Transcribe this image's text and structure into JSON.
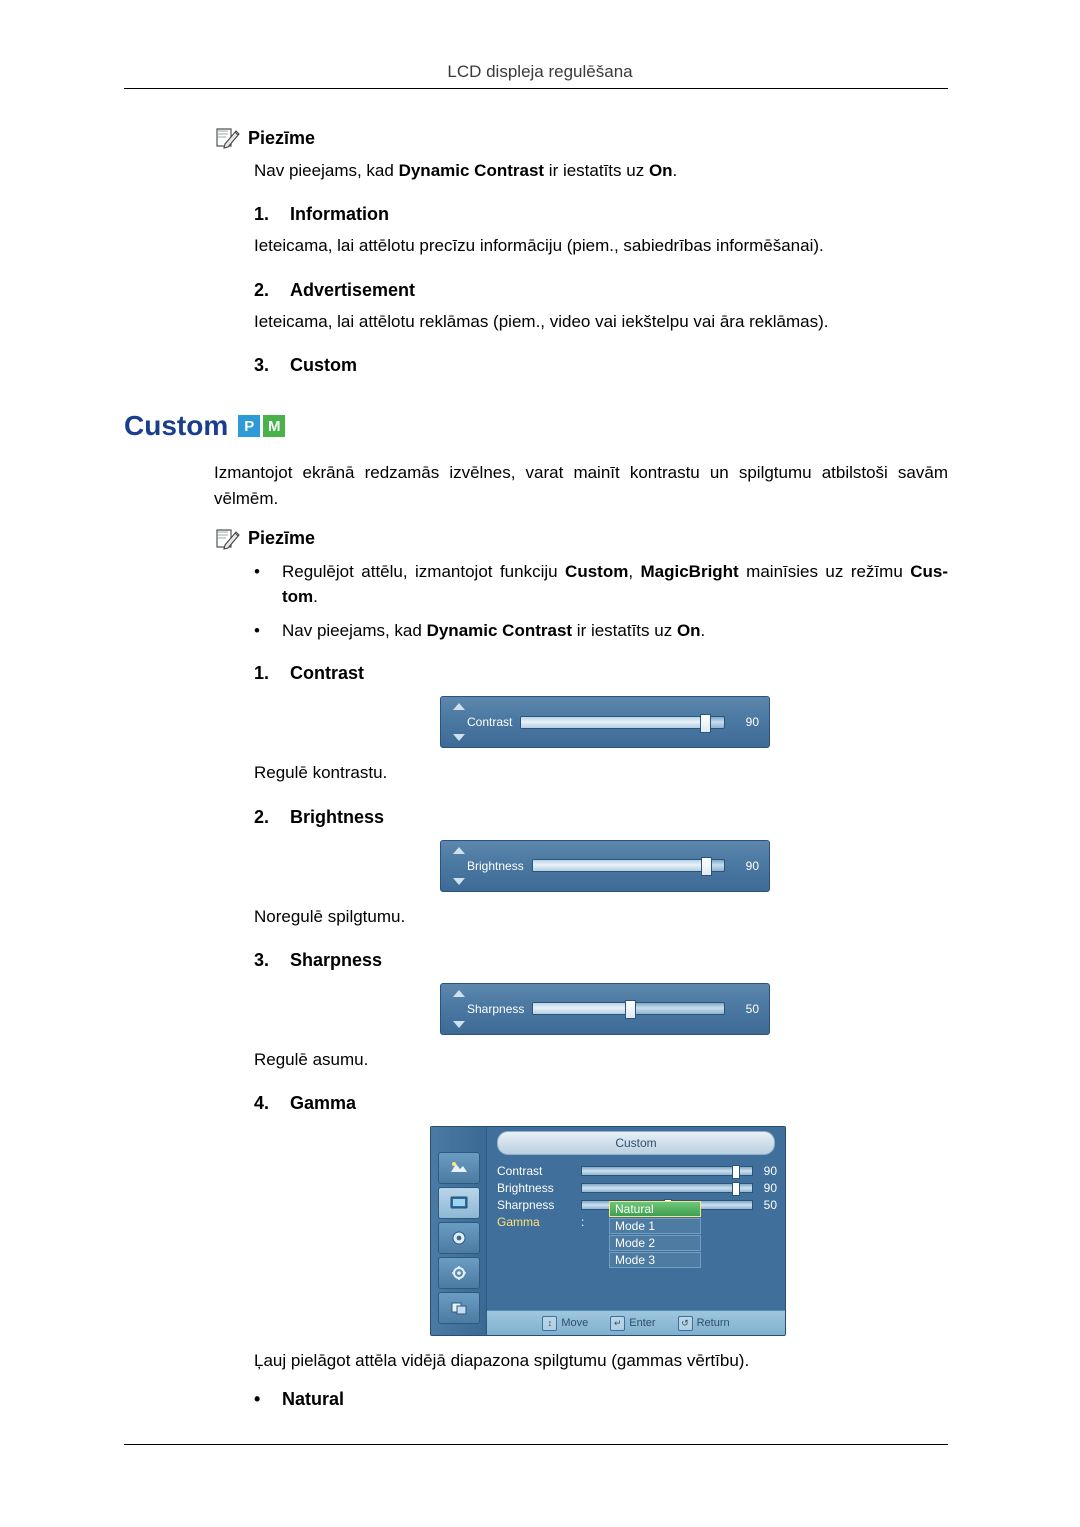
{
  "header": {
    "title": "LCD displeja regulēšana"
  },
  "notes": {
    "label": "Piezīme",
    "icon": "note-pencil-icon"
  },
  "section1": {
    "note_text_prefix": "Nav pieejams, kad ",
    "note_bold1": "Dynamic Contrast",
    "note_text_mid": " ir iestatīts uz ",
    "note_bold2": "On",
    "note_text_suffix": ".",
    "items": [
      {
        "num": "1.",
        "label": "Information",
        "desc": "Ieteicama, lai attēlotu precīzu informāciju (piem., sabiedrības informēšanai)."
      },
      {
        "num": "2.",
        "label": "Advertisement",
        "desc": "Ieteicama, lai attēlotu reklāmas (piem., video vai iekštelpu vai āra reklāmas)."
      },
      {
        "num": "3.",
        "label": "Custom",
        "desc": ""
      }
    ]
  },
  "custom": {
    "heading": "Custom",
    "badges": [
      {
        "letter": "P",
        "color": "#2e9ad6"
      },
      {
        "letter": "M",
        "color": "#49b34a"
      }
    ],
    "intro": "Izmantojot ekrānā redzamās izvēlnes, varat mainīt kontrastu un spilgtumu atbilstoši savām vēlmēm.",
    "note_label": "Piezīme",
    "bullets": [
      {
        "parts": [
          {
            "t": "Regulējot attēlu, izmantojot funkciju ",
            "b": false
          },
          {
            "t": "Custom",
            "b": true
          },
          {
            "t": ", ",
            "b": false
          },
          {
            "t": "MagicBright",
            "b": true
          },
          {
            "t": " mainīsies uz režīmu ",
            "b": false
          },
          {
            "t": "Cus-",
            "b": true
          },
          {
            "t": "tom",
            "b": true
          },
          {
            "t": ".",
            "b": false
          }
        ]
      },
      {
        "parts": [
          {
            "t": "Nav pieejams, kad ",
            "b": false
          },
          {
            "t": "Dynamic Contrast",
            "b": true
          },
          {
            "t": " ir iestatīts uz ",
            "b": false
          },
          {
            "t": "On",
            "b": true
          },
          {
            "t": ".",
            "b": false
          }
        ]
      }
    ],
    "items": [
      {
        "num": "1.",
        "label": "Contrast",
        "desc": "Regulē kontrastu.",
        "osd": {
          "name": "Contrast",
          "value": "90",
          "fill_pct": 90
        }
      },
      {
        "num": "2.",
        "label": "Brightness",
        "desc": "Noregulē spilgtumu.",
        "osd": {
          "name": "Brightness",
          "value": "90",
          "fill_pct": 90
        }
      },
      {
        "num": "3.",
        "label": "Sharpness",
        "desc": "Regulē asumu.",
        "osd": {
          "name": "Sharpness",
          "value": "50",
          "fill_pct": 50
        }
      },
      {
        "num": "4.",
        "label": "Gamma",
        "desc": "Ļauj pielāgot attēla vidējā diapazona spilgtumu (gammas vērtību).",
        "menu": {
          "title": "Custom",
          "rows": [
            {
              "name": "Contrast",
              "value": "90",
              "fill_pct": 90
            },
            {
              "name": "Brightness",
              "value": "90",
              "fill_pct": 90
            },
            {
              "name": "Sharpness",
              "value": "50",
              "fill_pct": 50
            }
          ],
          "gamma_row_label": "Gamma",
          "gamma_options": [
            "Natural",
            "Mode 1",
            "Mode 2",
            "Mode 3"
          ],
          "gamma_selected": "Natural",
          "footer": [
            {
              "glyph": "↕",
              "label": "Move"
            },
            {
              "glyph": "↵",
              "label": "Enter"
            },
            {
              "glyph": "↺",
              "label": "Return"
            }
          ],
          "side_icons": [
            "picture-icon",
            "display-icon",
            "sound-icon",
            "setup-icon",
            "multicontrol-icon"
          ]
        }
      }
    ],
    "gamma_sub_bullet": "Natural"
  }
}
